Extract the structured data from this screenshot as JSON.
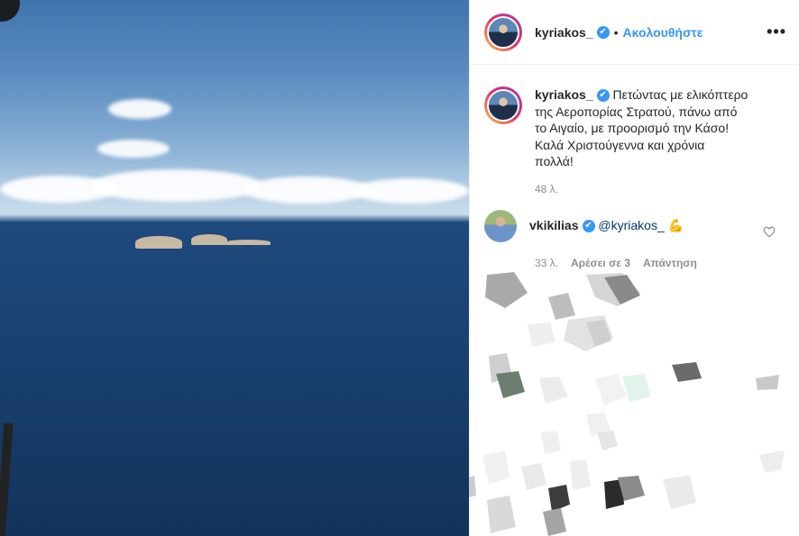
{
  "post": {
    "username": "kyriakos_",
    "verified_mark": "✔",
    "dot": "•",
    "follow_label": "Ακολουθήστε",
    "more_icon": "•••",
    "caption_line1": "Πετώντας με ελικόπτερο",
    "caption_line2": "της Αεροπορίας Στρατού, πάνω από",
    "caption_line3": "το Αιγαίο, με προορισμό την Κάσο!",
    "caption_line4": "Καλά Χριστούγεννα και χρόνια",
    "caption_line5": "πολλά!",
    "timestamp": "48 λ."
  },
  "comment": {
    "username": "vkikilias",
    "verified_mark": "✔",
    "mention": "@kyriakos_",
    "emoji": "💪",
    "timestamp": "33 λ.",
    "likes_label": "Αρέσει σε 3",
    "reply_label": "Απάντηση"
  },
  "colors": {
    "accent": "#3897f0",
    "muted": "#8e8e8e"
  }
}
